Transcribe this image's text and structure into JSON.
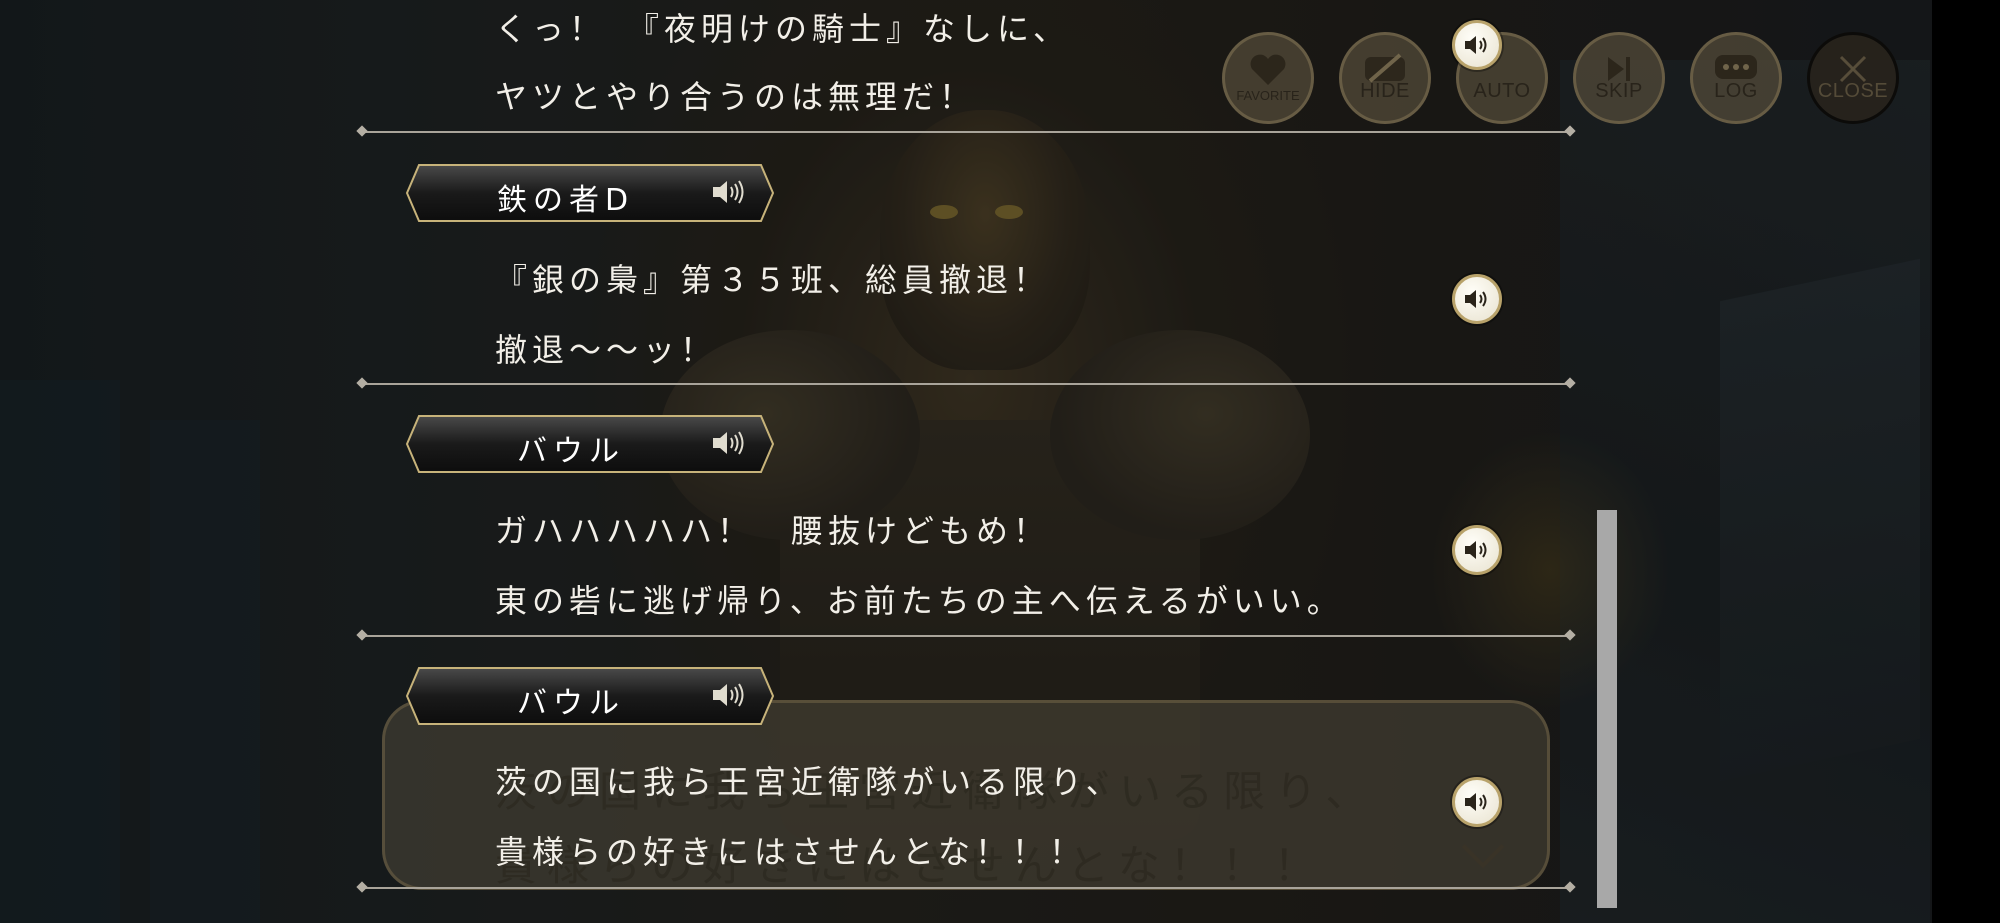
{
  "toolbar": {
    "favorite": "FAVORITE",
    "hide": "HIDE",
    "auto": "AUTO",
    "skip": "SKIP",
    "log": "LOG",
    "close": "CLOSE"
  },
  "log": {
    "entries": [
      {
        "speaker": "",
        "lines": [
          "くっ！　『夜明けの騎士』なしに、",
          "ヤツとやり合うのは無理だ！"
        ]
      },
      {
        "speaker": "鉄の者D",
        "lines": [
          "『銀の梟』第３５班、総員撤退！",
          "撤退～～ッ！"
        ]
      },
      {
        "speaker": "バウル",
        "lines": [
          "ガハハハハハ！　腰抜けどもめ！",
          "東の砦に逃げ帰り、お前たちの主へ伝えるがいい。"
        ]
      },
      {
        "speaker": "バウル",
        "lines": [
          "茨の国に我ら王宮近衛隊がいる限り、",
          "貴様らの好きにはさせんとな！！！"
        ]
      }
    ]
  },
  "game_dialogue": {
    "line1": "茨の国に我ら王宮近衛隊がいる限り、",
    "line2": "貴様らの好きにはさせんとな！！！"
  },
  "colors": {
    "accent_gold": "#b8a26a",
    "text": "#f2efe8",
    "separator": "#a9a49a"
  },
  "icons": {
    "voice": "speaker-icon",
    "favorite": "heart-icon",
    "hide": "eye-slash-icon",
    "auto": "auto-play-icon",
    "skip": "skip-icon",
    "log": "chat-bubble-icon",
    "close": "close-icon"
  }
}
